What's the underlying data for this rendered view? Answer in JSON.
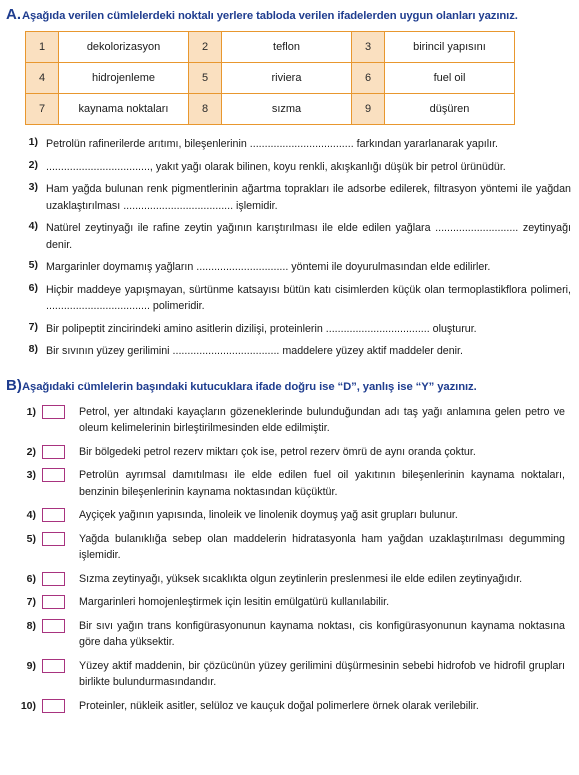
{
  "section_a": {
    "letter": "A.",
    "title": "Aşağıda verilen cümlelerdeki noktalı yerlere tabloda verilen ifadelerden uygun olanları yazınız.",
    "wordbank": [
      [
        {
          "num": "1",
          "term": "dekolorizasyon"
        },
        {
          "num": "2",
          "term": "teflon"
        },
        {
          "num": "3",
          "term": "birincil yapısını"
        }
      ],
      [
        {
          "num": "4",
          "term": "hidrojenleme"
        },
        {
          "num": "5",
          "term": "riviera"
        },
        {
          "num": "6",
          "term": "fuel oil"
        }
      ],
      [
        {
          "num": "7",
          "term": "kaynama noktaları"
        },
        {
          "num": "8",
          "term": "sızma"
        },
        {
          "num": "9",
          "term": "düşüren"
        }
      ]
    ],
    "questions": [
      {
        "num": "1)",
        "text": "Petrolün rafinerilerde arıtımı, bileşenlerinin ................................... farkından yararlanarak yapılır."
      },
      {
        "num": "2)",
        "text": "..................................., yakıt yağı olarak bilinen, koyu renkli, akışkanlığı düşük bir petrol ürünüdür."
      },
      {
        "num": "3)",
        "text": "Ham yağda bulunan renk pigmentlerinin ağartma toprakları ile adsorbe edilerek, filtrasyon yöntemi ile yağdan uzaklaştırılması ..................................... işlemidir."
      },
      {
        "num": "4)",
        "text": "Natürel zeytinyağı ile rafine zeytin yağının karıştırılması ile elde edilen yağlara ............................ zeytinyağı denir."
      },
      {
        "num": "5)",
        "text": "Margarinler doymamış yağların ............................... yöntemi ile doyurulmasından elde edilirler."
      },
      {
        "num": "6)",
        "text": "Hiçbir maddeye yapışmayan, sürtünme katsayısı bütün katı cisimlerden küçük olan termoplastikflora polimeri, ................................... polimeridir."
      },
      {
        "num": "7)",
        "text": "Bir polipeptit zincirindeki amino asitlerin dizilişi, proteinlerin ................................... oluşturur."
      },
      {
        "num": "8)",
        "text": "Bir sıvının yüzey gerilimini .................................... maddelere yüzey aktif maddeler denir."
      }
    ]
  },
  "section_b": {
    "letter": "B)",
    "title": "Aşağıdaki cümlelerin başındaki kutucuklara ifade doğru ise “D”, yanlış ise “Y” yazınız.",
    "questions": [
      {
        "num": "1)",
        "text": "Petrol, yer altındaki kayaçların gözeneklerinde bulunduğundan adı taş yağı anlamına gelen petro ve oleum kelimelerinin birleştirilmesinden elde edilmiştir."
      },
      {
        "num": "2)",
        "text": "Bir bölgedeki petrol rezerv miktarı çok ise, petrol rezerv ömrü de aynı oranda çoktur."
      },
      {
        "num": "3)",
        "text": "Petrolün ayrımsal damıtılması ile elde edilen fuel oil yakıtının bileşenlerinin kaynama noktaları, benzinin bileşenlerinin kaynama noktasından küçüktür."
      },
      {
        "num": "4)",
        "text": "Ayçiçek yağının yapısında, linoleik ve linolenik doymuş yağ asit grupları bulunur."
      },
      {
        "num": "5)",
        "text": "Yağda bulanıklığa sebep olan maddelerin hidratasyonla ham yağdan uzaklaştırılması degumming işlemidir."
      },
      {
        "num": "6)",
        "text": "Sızma zeytinyağı, yüksek sıcaklıkta olgun zeytinlerin preslenmesi ile elde edilen zeytinyağıdır."
      },
      {
        "num": "7)",
        "text": "Margarinleri homojenleştirmek için lesitin emülgatürü kullanılabilir."
      },
      {
        "num": "8)",
        "text": "Bir sıvı yağın trans konfigürasyonunun kaynama noktası, cis konfigürasyonunun kaynama noktasına göre daha yüksektir."
      },
      {
        "num": "9)",
        "text": "Yüzey aktif maddenin, bir çözücünün yüzey gerilimini düşürmesinin sebebi hidrofob ve hidrofil grupları birlikte bulundurmasındandır."
      },
      {
        "num": "10)",
        "text": "Proteinler, nükleik asitler, selüloz ve kauçuk doğal polimerlere örnek olarak verilebilir."
      }
    ]
  },
  "colors": {
    "header_blue": "#1f3d8f",
    "table_border_orange": "#e8972e",
    "table_num_bg": "#fae0c0",
    "checkbox_border": "#a8337f"
  }
}
